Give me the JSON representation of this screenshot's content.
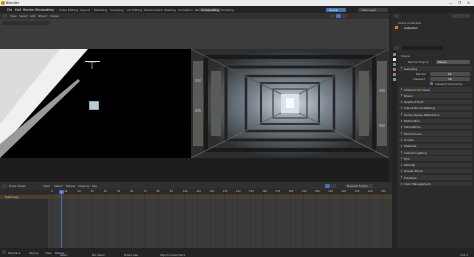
{
  "window": {
    "title": "Blender",
    "controls": [
      "—",
      "❐",
      "✕"
    ]
  },
  "menubar": {
    "items": [
      "File",
      "Edit",
      "Render",
      "Window",
      "Help"
    ],
    "editor_label": "Video Editing",
    "tabs": [
      "Layout",
      "Modeling",
      "Sculpting",
      "UV Editing",
      "Texture Paint",
      "Shading",
      "Animation",
      "Rendering",
      "Compositing",
      "Scripting"
    ],
    "active_tab": "Compositing",
    "scene_label": "Scene",
    "view_layer_label": "View Layer"
  },
  "outliner": {
    "title": "Scene Collection",
    "items": [
      "Collection"
    ]
  },
  "viewport_header": {
    "buttons": [
      "View",
      "Select",
      "Add",
      "Object",
      "Image"
    ]
  },
  "properties": {
    "scene_label": "Scene",
    "render_engine_label": "Render Engine",
    "render_engine_value": "Eevee",
    "sampling_label": "Sampling",
    "render_label": "Render",
    "render_value": "64",
    "viewport_label": "Viewport",
    "viewport_value": "16",
    "denoise_label": "Viewport Denoising",
    "sections": [
      "Ambient Occlusion",
      "Bloom",
      "Depth of Field",
      "Subsurface Scattering",
      "Screen Space Reflections",
      "Motion Blur",
      "Volumetrics",
      "Performance",
      "Curves",
      "Shadows",
      "Indirect Lighting",
      "Film",
      "Simplify",
      "Grease Pencil",
      "Freestyle",
      "Color Management"
    ]
  },
  "timeline": {
    "header": [
      "Dope Sheet",
      "View",
      "Select",
      "Marker",
      "Channel",
      "Key"
    ],
    "summary_label": "Summary",
    "mode_label": "Nearest Frame",
    "current_frame": "1",
    "ticks": [
      "0",
      "10",
      "20",
      "30",
      "40",
      "50",
      "60",
      "70",
      "80",
      "90",
      "100",
      "110",
      "120",
      "130",
      "140",
      "150",
      "160",
      "170",
      "180",
      "190",
      "200",
      "210",
      "220",
      "230",
      "240",
      "250"
    ]
  },
  "statusbar": {
    "items": [
      "Playback",
      "Keying",
      "View",
      "Marker"
    ],
    "hints": [
      "Select",
      "Box Select",
      "Rotate View",
      "Object Context Menu"
    ],
    "version": "2.91.0"
  },
  "colors": {
    "accent": "#4772b3",
    "playhead": "#4772b3",
    "active_orange": "#e87d0d"
  }
}
